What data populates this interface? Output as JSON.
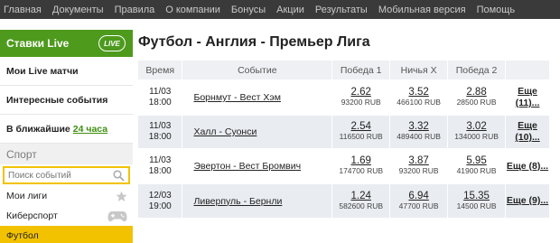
{
  "topnav": [
    "Главная",
    "Документы",
    "Правила",
    "О компании",
    "Бонусы",
    "Акции",
    "Результаты",
    "Мобильная версия",
    "Помощь"
  ],
  "sidebar": {
    "live_title": "Ставки Live",
    "live_badge": "LIVE",
    "items": [
      {
        "label": "Мои Live матчи",
        "highlight": ""
      },
      {
        "label": "Интересные события",
        "highlight": ""
      },
      {
        "label": "В ближайшие",
        "highlight": "24 часа"
      }
    ],
    "sport_title": "Спорт",
    "search_placeholder": "Поиск событий",
    "sub_items": [
      {
        "label": "Мои лиги",
        "icon": "star-icon"
      },
      {
        "label": "Киберспорт",
        "icon": "gamepad-icon"
      },
      {
        "label": "Футбол",
        "icon": ""
      }
    ]
  },
  "main": {
    "title": "Футбол - Англия - Премьер Лига",
    "columns": [
      "Время",
      "Событие",
      "Победа 1",
      "Ничья X",
      "Победа 2",
      ""
    ],
    "rows": [
      {
        "date": "11/03",
        "time": "18:00",
        "event": "Борнмут - Вест Хэм",
        "w1": "2.62",
        "w1v": "93200 RUB",
        "x": "3.52",
        "xv": "466100 RUB",
        "w2": "2.88",
        "w2v": "28500 RUB",
        "more": "Еще (11)..."
      },
      {
        "date": "11/03",
        "time": "18:00",
        "event": "Халл - Суонси",
        "w1": "2.54",
        "w1v": "116500 RUB",
        "x": "3.32",
        "xv": "489400 RUB",
        "w2": "3.02",
        "w2v": "134000 RUB",
        "more": "Еще (10)..."
      },
      {
        "date": "11/03",
        "time": "18:00",
        "event": "Эвертон - Вест Бромвич",
        "w1": "1.69",
        "w1v": "174700 RUB",
        "x": "3.87",
        "xv": "93200 RUB",
        "w2": "5.95",
        "w2v": "41900 RUB",
        "more": "Еще (8)..."
      },
      {
        "date": "12/03",
        "time": "19:00",
        "event": "Ливерпуль - Бернли",
        "w1": "1.24",
        "w1v": "582600 RUB",
        "x": "6.94",
        "xv": "47700 RUB",
        "w2": "15.35",
        "w2v": "14500 RUB",
        "more": "Еще (9)..."
      }
    ]
  },
  "colors": {
    "live_green": "#4d9a1d",
    "active_yellow": "#f2c200",
    "topnav_bg": "#3a3a3a"
  }
}
